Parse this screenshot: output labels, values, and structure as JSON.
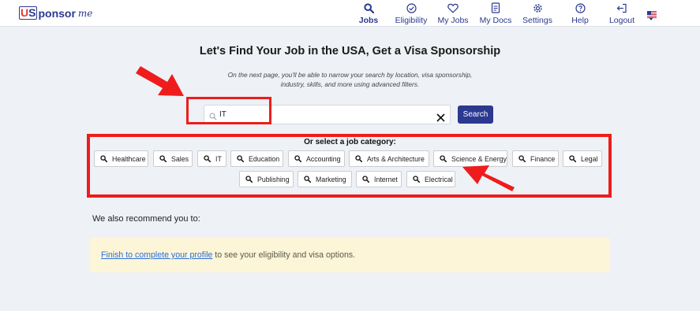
{
  "brand": {
    "u": "U",
    "s": "S",
    "rest": "ponsor",
    "me": "me"
  },
  "nav": {
    "items": [
      {
        "label": "Jobs",
        "icon": "search-icon",
        "active": true
      },
      {
        "label": "Eligibility",
        "icon": "check-circle-icon",
        "active": false
      },
      {
        "label": "My Jobs",
        "icon": "heart-icon",
        "active": false
      },
      {
        "label": "My Docs",
        "icon": "document-icon",
        "active": false
      },
      {
        "label": "Settings",
        "icon": "gear-icon",
        "active": false
      },
      {
        "label": "Help",
        "icon": "help-icon",
        "active": false
      },
      {
        "label": "Logout",
        "icon": "logout-icon",
        "active": false
      }
    ],
    "language_icon": "us-flag-icon"
  },
  "hero": {
    "title": "Let's Find Your Job in the USA, Get a Visa Sponsorship",
    "subtitle_line1": "On the next page, you'll be able to narrow your search by location, visa sponsorship,",
    "subtitle_line2": "industry, skills, and more using advanced filters."
  },
  "search": {
    "value": "IT",
    "button_label": "Search"
  },
  "categories": {
    "heading": "Or select a job category:",
    "items": [
      "Healthcare",
      "Sales",
      "IT",
      "Education",
      "Accounting",
      "Arts & Architecture",
      "Science & Energy",
      "Finance",
      "Legal",
      "Publishing",
      "Marketing",
      "Internet",
      "Electrical"
    ]
  },
  "recommend": {
    "label": "We also recommend you to:",
    "link_text": "Finish to complete your profile",
    "rest_text": " to see your eligibility and visa options."
  },
  "colors": {
    "brand": "#2b3990",
    "highlight": "#ee1c1c",
    "notice_bg": "#fdf5d8",
    "link": "#2b6fd6"
  }
}
